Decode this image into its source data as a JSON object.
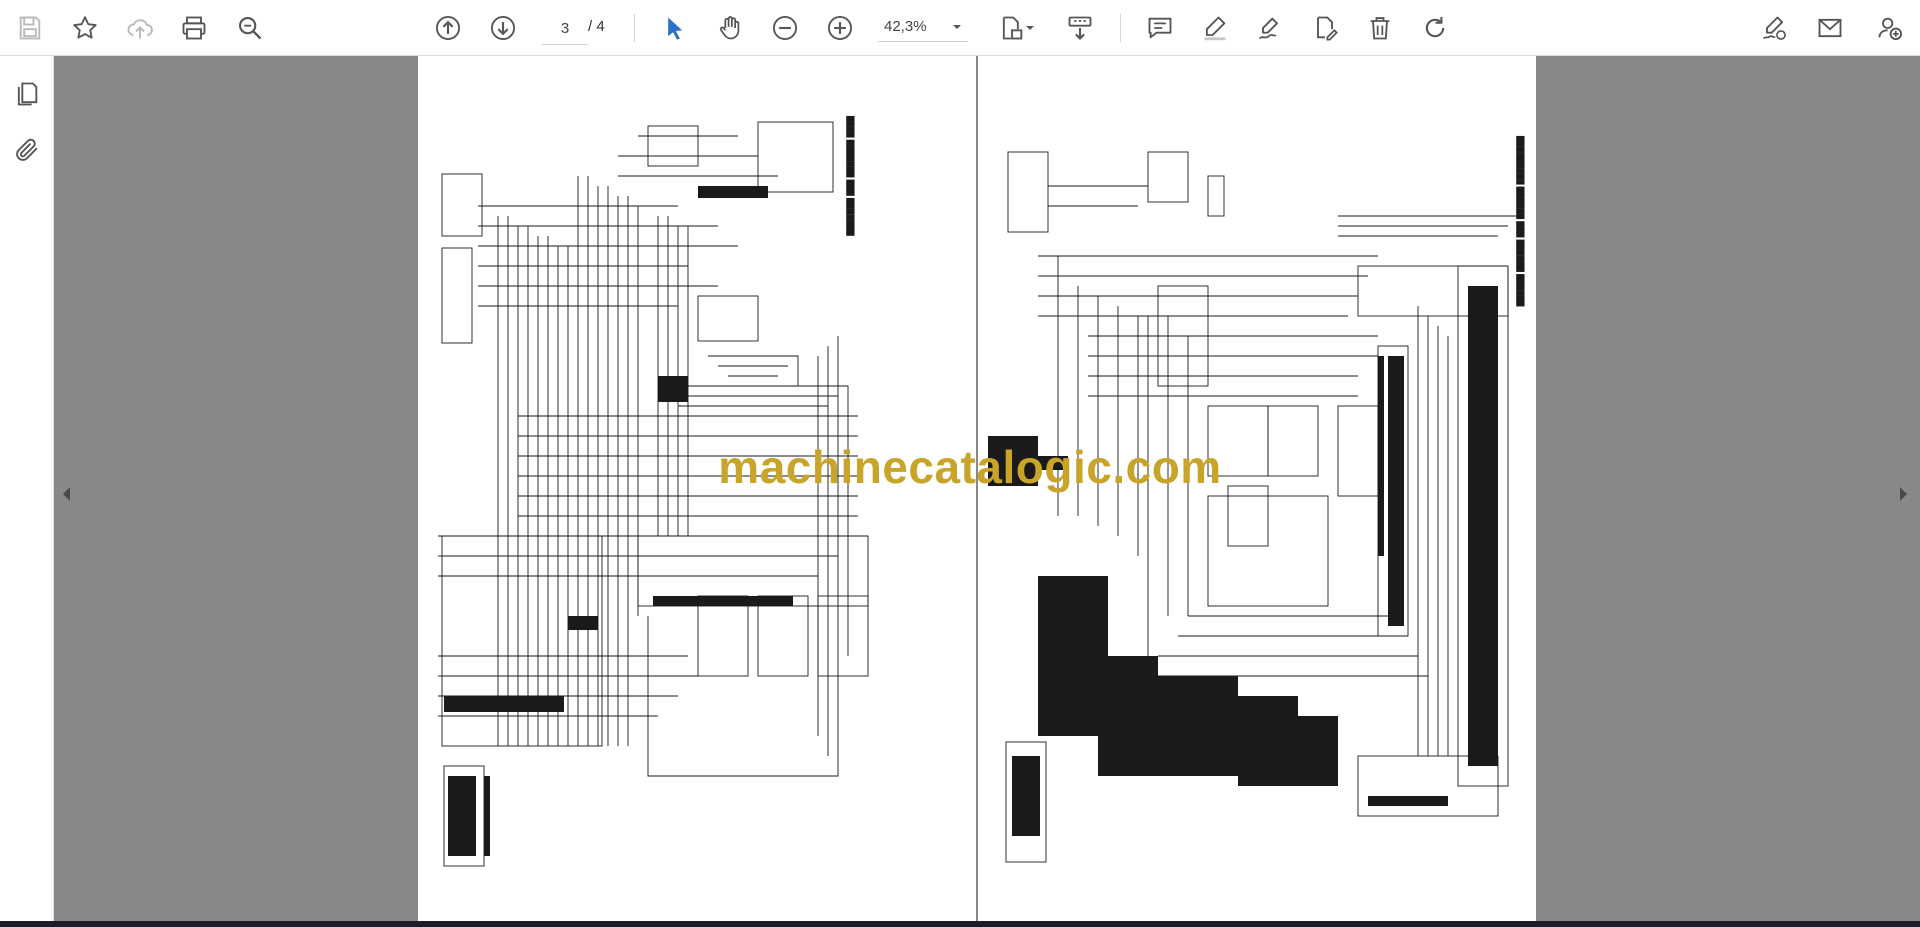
{
  "toolbar": {
    "page": {
      "current": "3",
      "total": "/ 4"
    },
    "zoom": {
      "value": "42,3%"
    },
    "left_icons": [
      "save-icon",
      "star-icon",
      "cloud-upload-icon",
      "print-icon",
      "zoom-search-icon"
    ],
    "nav_icons": [
      "page-up-icon",
      "page-down-icon"
    ],
    "tool_icons": [
      "select-cursor-icon",
      "hand-tool-icon",
      "zoom-out-icon",
      "zoom-in-icon"
    ],
    "right_icons": [
      "comment-icon",
      "highlight-pen-icon",
      "draw-icon",
      "stamp-icon",
      "trash-icon",
      "rotate-icon",
      "sign-icon",
      "email-icon",
      "add-user-icon"
    ],
    "accent": "#2c6ec9"
  },
  "sidebar": {
    "icons": [
      "pages-icon",
      "attachment-icon"
    ]
  },
  "document": {
    "watermark": "machinecatalogic.com",
    "watermark_color": "#c9a42a",
    "background": "#888888"
  }
}
